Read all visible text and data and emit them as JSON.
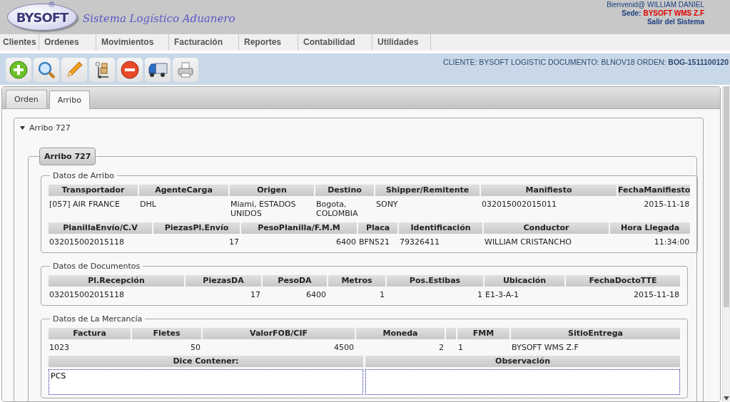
{
  "header": {
    "logo": {
      "name": "BYSOFT",
      "mark": "®"
    },
    "title": "Sistema Logístico Aduanero",
    "welcome": "Bienvenid@ WILLIAM DANIEL",
    "site_label": "Sede:",
    "site": "BYSOFT WMS Z.F",
    "logout": "Salir del Sistema"
  },
  "menu": [
    "Clientes",
    "Ordenes",
    "Movimientos",
    "Facturación",
    "Reportes",
    "Contabilidad",
    "Utilidades"
  ],
  "toolbar": {
    "info": "CLIENTE: BYSOFT LOGISTIC DOCUMENTO: BLNOV18 ORDEN: **BOG-1511100120**"
  },
  "tabs": [
    {
      "label": "Orden",
      "selected": false
    },
    {
      "label": "Arribo",
      "selected": true
    }
  ],
  "accordion": {
    "title": "Arribo 727",
    "expanded": true
  },
  "panel_title": "Arribo 727",
  "sections": [
    {
      "title": "Datos de Arribo",
      "tables": [
        {
          "columns": [
            {
              "label": "Transportador",
              "value": "[057] AIR FRANCE"
            },
            {
              "label": "AgenteCarga",
              "value": "DHL"
            },
            {
              "label": "Origen",
              "value": "Miami, ESTADOS UNIDOS"
            },
            {
              "label": "Destino",
              "value": "Bogota, COLOMBIA"
            },
            {
              "label": "Shipper/Remitente",
              "value": "SONY"
            },
            {
              "label": "Manifiesto",
              "value": "032015002015011"
            },
            {
              "label": "FechaManifiesto",
              "value": "2015-11-18"
            }
          ]
        },
        {
          "columns": [
            {
              "label": "PlanillaEnvío/C.V",
              "value": "032015002015118"
            },
            {
              "label": "PiezasPl.Envío",
              "value": "17"
            },
            {
              "label": "PesoPlanilla/F.M.M",
              "value": "6400"
            },
            {
              "label": "Placa",
              "value": "BFN521"
            },
            {
              "label": "Identificación",
              "value": "79326411"
            },
            {
              "label": "Conductor",
              "value": "WILLIAM CRISTANCHO"
            },
            {
              "label": "Hora Llegada",
              "value": "11:34:00"
            }
          ]
        }
      ]
    },
    {
      "title": "Datos de Documentos",
      "tables": [
        {
          "columns": [
            {
              "label": "Pl.Recepción",
              "value": "032015002015118"
            },
            {
              "label": "PiezasDA",
              "value": "17"
            },
            {
              "label": "PesoDA",
              "value": "6400"
            },
            {
              "label": "Metros",
              "value": "1"
            },
            {
              "label": "Pos.Estibas",
              "value": "1"
            },
            {
              "label": "Ubicación",
              "value": "E1-3-A-1"
            },
            {
              "label": "FechaDoctoTTE",
              "value": "2015-11-18"
            }
          ]
        }
      ]
    },
    {
      "title": "Datos de La Mercancía",
      "tables": [
        {
          "columns": [
            {
              "label": "Factura",
              "value": "1023"
            },
            {
              "label": "Fletes",
              "value": "50"
            },
            {
              "label": "ValorFOB/CIF",
              "value": "4500"
            },
            {
              "label": "Moneda",
              "value": "2"
            },
            {},
            {
              "label": "FMM",
              "value": "1"
            },
            {
              "label": "SitioEntrega",
              "value": "BYSOFT WMS Z.F"
            }
          ]
        }
      ],
      "notes": [
        {
          "label": "Dice Contener:",
          "value": "PCS"
        },
        {
          "label": "Observación"
        }
      ]
    }
  ]
}
